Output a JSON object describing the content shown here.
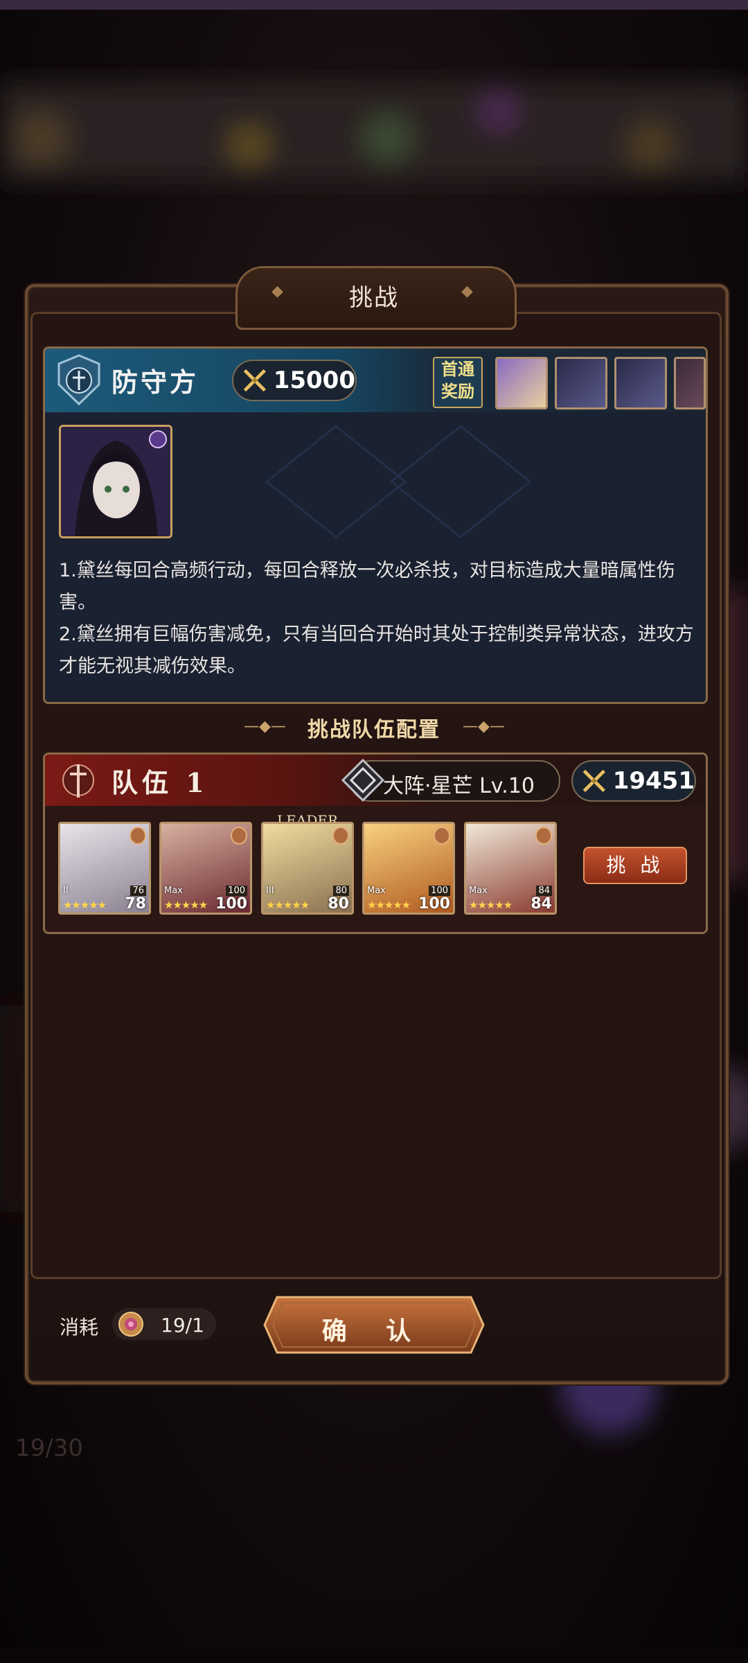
{
  "dialog": {
    "title": "挑战"
  },
  "defender": {
    "title": "防守方",
    "power": "15000",
    "reward_label": "首通\n奖励",
    "reward_items": [
      "reward-item-1",
      "reward-item-2",
      "reward-item-3",
      "reward-item-4"
    ],
    "boss_stars": "★★★★★",
    "description": "1.黛丝每回合高频行动，每回合释放一次必杀技，对目标造成大量暗属性伤害。\n2.黛丝拥有巨幅伤害减免，只有当回合开始时其处于控制类异常状态，进攻方才能无视其减伤效果。"
  },
  "team_config": {
    "section_title": "挑战队伍配置",
    "team_title": "队伍 1",
    "formation": "大阵·星芒 Lv.10",
    "power": "19451",
    "leader_label": "LEADER",
    "challenge_button": "挑 战",
    "heroes": [
      {
        "stars": "★★★★★",
        "level": "78",
        "tag": "II",
        "sub": "76",
        "color": "#d8d2d6"
      },
      {
        "stars": "★★★★★",
        "level": "100",
        "tag": "Max",
        "sub": "100",
        "color": "#8a4a44"
      },
      {
        "stars": "★★★★★",
        "level": "80",
        "tag": "III",
        "sub": "80",
        "color": "#d9b870"
      },
      {
        "stars": "★★★★★",
        "level": "100",
        "tag": "Max",
        "sub": "100",
        "color": "#e8a040"
      },
      {
        "stars": "★★★★★",
        "level": "84",
        "tag": "Max",
        "sub": "84",
        "color": "#d8cfc0"
      }
    ]
  },
  "footer": {
    "cost_label": "消耗",
    "cost_value": "19/1",
    "confirm_button": "确 认"
  },
  "background": {
    "stamina_text": "19/30"
  },
  "colors": {
    "defender_header": "#1d5a7a",
    "team_header": "#7a1a16",
    "frame_gold": "#8a6a48",
    "challenge_button": "#c4522e"
  }
}
